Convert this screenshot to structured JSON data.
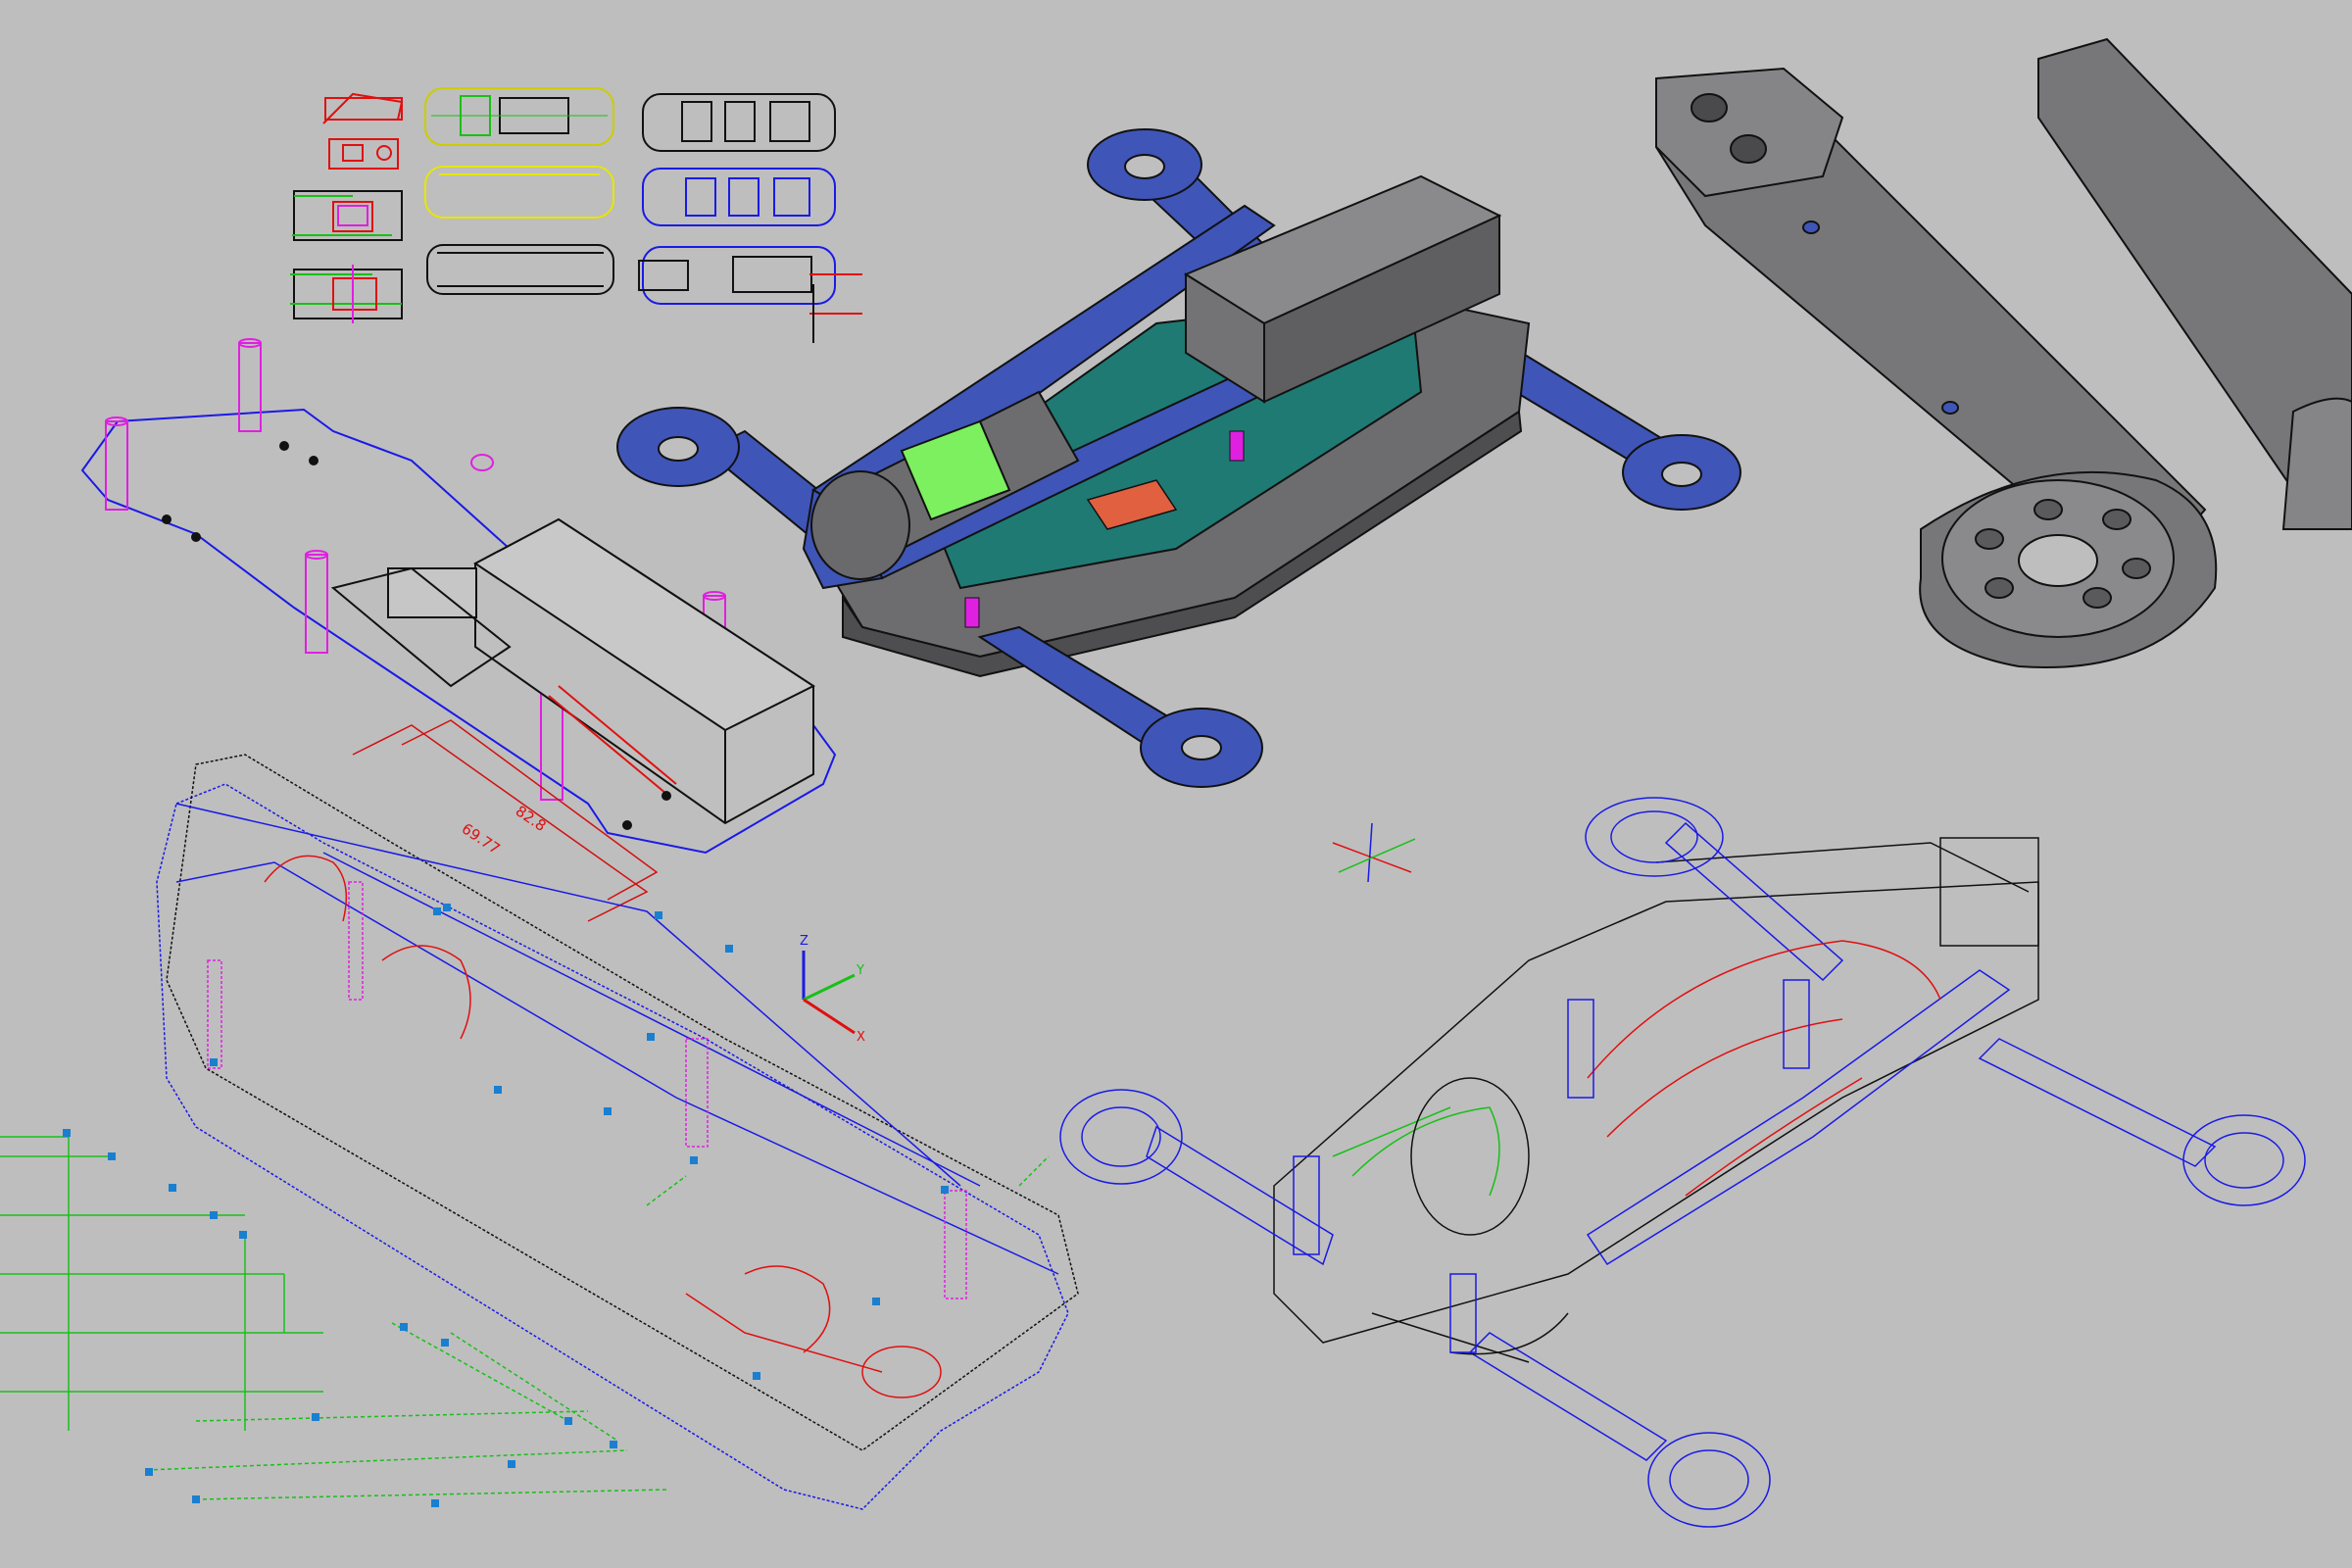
{
  "viewport": {
    "background": "#bebebe",
    "dimension_labels": [
      "82.8",
      "69.77"
    ],
    "ucs_axis_labels": [
      "Z",
      "Y",
      "X"
    ]
  },
  "colors": {
    "wire_blue": "#1a1ae6",
    "wire_red": "#e01010",
    "wire_green": "#18c018",
    "wire_magenta": "#e020e0",
    "wire_yellow": "#e6e600",
    "wire_black": "#111111",
    "shaded_blue": "#3f55b8",
    "shaded_teal": "#1f7a74",
    "shaded_grey": "#6d6d6f",
    "battery_green": "#7df060",
    "dimension_red": "#d11111"
  },
  "icons": [
    "ucs-axis-icon",
    "crosshair-cursor-icon",
    "grip-point-icon"
  ]
}
